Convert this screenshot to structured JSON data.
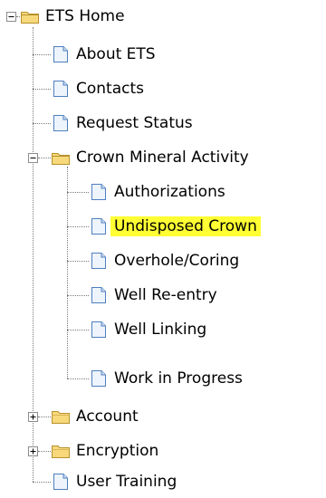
{
  "tree": {
    "root": {
      "label": "ETS Home",
      "expanded": true,
      "icon": "folder-open-icon"
    },
    "items": [
      {
        "label": "About ETS",
        "icon": "page-icon"
      },
      {
        "label": "Contacts",
        "icon": "page-icon"
      },
      {
        "label": "Request Status",
        "icon": "page-icon"
      },
      {
        "label": "Crown Mineral Activity",
        "icon": "folder-open-icon",
        "expanded": true,
        "children": [
          {
            "label": "Authorizations",
            "icon": "page-icon"
          },
          {
            "label": "Undisposed Crown",
            "icon": "page-icon",
            "selected": true
          },
          {
            "label": "Overhole/Coring",
            "icon": "page-icon"
          },
          {
            "label": "Well Re-entry",
            "icon": "page-icon"
          },
          {
            "label": "Well Linking",
            "icon": "page-icon"
          },
          {
            "label": "Work in Progress",
            "icon": "page-icon"
          }
        ]
      },
      {
        "label": "Account",
        "icon": "folder-closed-icon",
        "expanded": false
      },
      {
        "label": "Encryption",
        "icon": "folder-closed-icon",
        "expanded": false
      },
      {
        "label": "User Training",
        "icon": "page-icon"
      }
    ]
  },
  "colors": {
    "selection_highlight": "#ffff33",
    "folder_fill": "#f7d97c",
    "page_border": "#4f7fbf",
    "connector": "#7a7a7a"
  }
}
